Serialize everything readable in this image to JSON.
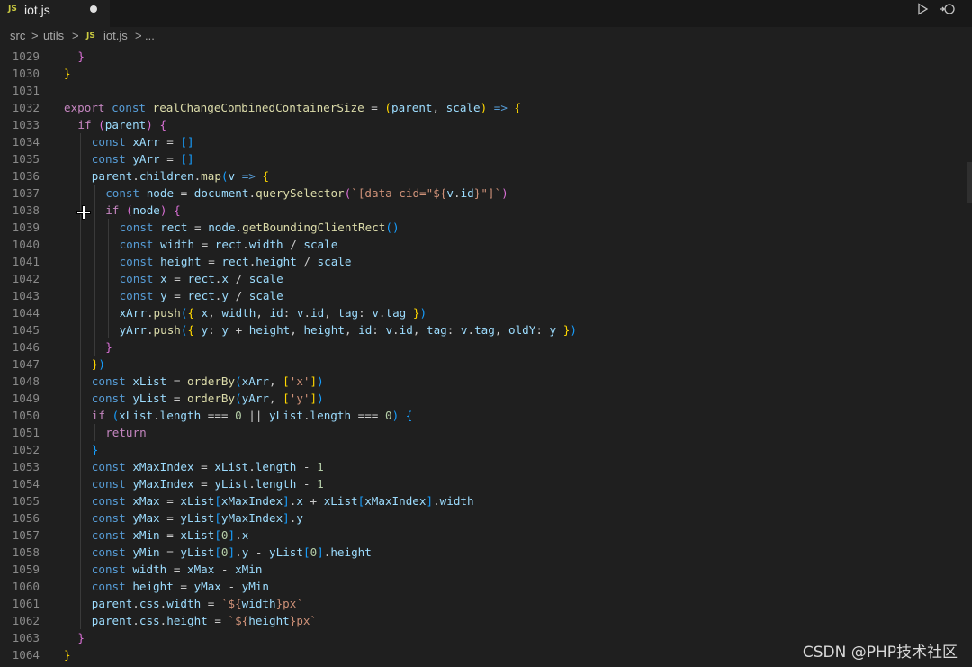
{
  "tab": {
    "badge": "JS",
    "title": "iot.js"
  },
  "toolbar": {
    "run_icon": "play-icon",
    "split_icon": "split-editor-icon"
  },
  "breadcrumb": {
    "src": "src",
    "sep1": ">",
    "utils": "utils",
    "sep2": ">",
    "badge": "JS",
    "file": "iot.js",
    "sep3": ">",
    "more": "..."
  },
  "watermark": "CSDN @PHP技术社区",
  "lines": [
    {
      "n": "1029",
      "ind": 1,
      "t": [
        [
          "}",
          "b2"
        ]
      ]
    },
    {
      "n": "1030",
      "ind": 0,
      "t": [
        [
          "}",
          "b1"
        ]
      ]
    },
    {
      "n": "1031",
      "ind": 0,
      "t": []
    },
    {
      "n": "1032",
      "ind": 0,
      "t": [
        [
          "export",
          "kwc"
        ],
        [
          " "
        ],
        [
          "const",
          "kw"
        ],
        [
          " "
        ],
        [
          "realChangeCombinedContainerSize",
          "fn"
        ],
        [
          " = "
        ],
        [
          "(",
          "b1"
        ],
        [
          "parent",
          "vr"
        ],
        [
          ", "
        ],
        [
          "scale",
          "vr"
        ],
        [
          ")",
          "b1"
        ],
        [
          " "
        ],
        [
          "=>",
          "kw"
        ],
        [
          " "
        ],
        [
          "{",
          "b1"
        ]
      ]
    },
    {
      "n": "1033",
      "ind": 1,
      "t": [
        [
          "if",
          "kwc"
        ],
        [
          " "
        ],
        [
          "(",
          "b2"
        ],
        [
          "parent",
          "vr"
        ],
        [
          ")",
          "b2"
        ],
        [
          " "
        ],
        [
          "{",
          "b2"
        ]
      ]
    },
    {
      "n": "1034",
      "ind": 2,
      "t": [
        [
          "const",
          "kw"
        ],
        [
          " "
        ],
        [
          "xArr",
          "vr"
        ],
        [
          " = "
        ],
        [
          "[]",
          "b3"
        ]
      ]
    },
    {
      "n": "1035",
      "ind": 2,
      "t": [
        [
          "const",
          "kw"
        ],
        [
          " "
        ],
        [
          "yArr",
          "vr"
        ],
        [
          " = "
        ],
        [
          "[]",
          "b3"
        ]
      ]
    },
    {
      "n": "1036",
      "ind": 2,
      "t": [
        [
          "parent",
          "vr"
        ],
        [
          "."
        ],
        [
          "children",
          "vr"
        ],
        [
          "."
        ],
        [
          "map",
          "fn"
        ],
        [
          "(",
          "b3"
        ],
        [
          "v",
          "vr"
        ],
        [
          " "
        ],
        [
          "=>",
          "kw"
        ],
        [
          " "
        ],
        [
          "{",
          "b1"
        ]
      ]
    },
    {
      "n": "1037",
      "ind": 3,
      "t": [
        [
          "const",
          "kw"
        ],
        [
          " "
        ],
        [
          "node",
          "vr"
        ],
        [
          " = "
        ],
        [
          "document",
          "vr"
        ],
        [
          "."
        ],
        [
          "querySelector",
          "fn"
        ],
        [
          "(",
          "b2"
        ],
        [
          "`[data-cid=\"${",
          "st"
        ],
        [
          "v",
          "vr"
        ],
        [
          "."
        ],
        [
          "id",
          "vr"
        ],
        [
          "}\"]`",
          "st"
        ],
        [
          ")",
          "b2"
        ]
      ]
    },
    {
      "n": "1038",
      "ind": 3,
      "t": [
        [
          "if",
          "kwc"
        ],
        [
          " "
        ],
        [
          "(",
          "b2"
        ],
        [
          "node",
          "vr"
        ],
        [
          ")",
          "b2"
        ],
        [
          " "
        ],
        [
          "{",
          "b2"
        ]
      ]
    },
    {
      "n": "1039",
      "ind": 4,
      "t": [
        [
          "const",
          "kw"
        ],
        [
          " "
        ],
        [
          "rect",
          "vr"
        ],
        [
          " = "
        ],
        [
          "node",
          "vr"
        ],
        [
          "."
        ],
        [
          "getBoundingClientRect",
          "fn"
        ],
        [
          "()",
          "b3"
        ]
      ]
    },
    {
      "n": "1040",
      "ind": 4,
      "t": [
        [
          "const",
          "kw"
        ],
        [
          " "
        ],
        [
          "width",
          "vr"
        ],
        [
          " = "
        ],
        [
          "rect",
          "vr"
        ],
        [
          "."
        ],
        [
          "width",
          "vr"
        ],
        [
          " / "
        ],
        [
          "scale",
          "vr"
        ]
      ]
    },
    {
      "n": "1041",
      "ind": 4,
      "t": [
        [
          "const",
          "kw"
        ],
        [
          " "
        ],
        [
          "height",
          "vr"
        ],
        [
          " = "
        ],
        [
          "rect",
          "vr"
        ],
        [
          "."
        ],
        [
          "height",
          "vr"
        ],
        [
          " / "
        ],
        [
          "scale",
          "vr"
        ]
      ]
    },
    {
      "n": "1042",
      "ind": 4,
      "t": [
        [
          "const",
          "kw"
        ],
        [
          " "
        ],
        [
          "x",
          "vr"
        ],
        [
          " = "
        ],
        [
          "rect",
          "vr"
        ],
        [
          "."
        ],
        [
          "x",
          "vr"
        ],
        [
          " / "
        ],
        [
          "scale",
          "vr"
        ]
      ]
    },
    {
      "n": "1043",
      "ind": 4,
      "t": [
        [
          "const",
          "kw"
        ],
        [
          " "
        ],
        [
          "y",
          "vr"
        ],
        [
          " = "
        ],
        [
          "rect",
          "vr"
        ],
        [
          "."
        ],
        [
          "y",
          "vr"
        ],
        [
          " / "
        ],
        [
          "scale",
          "vr"
        ]
      ]
    },
    {
      "n": "1044",
      "ind": 4,
      "t": [
        [
          "xArr",
          "vr"
        ],
        [
          "."
        ],
        [
          "push",
          "fn"
        ],
        [
          "(",
          "b3"
        ],
        [
          "{",
          "b1"
        ],
        [
          " "
        ],
        [
          "x",
          "vr"
        ],
        [
          ", "
        ],
        [
          "width",
          "vr"
        ],
        [
          ", "
        ],
        [
          "id",
          "vr"
        ],
        [
          ": "
        ],
        [
          "v",
          "vr"
        ],
        [
          "."
        ],
        [
          "id",
          "vr"
        ],
        [
          ", "
        ],
        [
          "tag",
          "vr"
        ],
        [
          ": "
        ],
        [
          "v",
          "vr"
        ],
        [
          "."
        ],
        [
          "tag",
          "vr"
        ],
        [
          " "
        ],
        [
          "}",
          "b1"
        ],
        [
          ")",
          "b3"
        ]
      ]
    },
    {
      "n": "1045",
      "ind": 4,
      "t": [
        [
          "yArr",
          "vr"
        ],
        [
          "."
        ],
        [
          "push",
          "fn"
        ],
        [
          "(",
          "b3"
        ],
        [
          "{",
          "b1"
        ],
        [
          " "
        ],
        [
          "y",
          "vr"
        ],
        [
          ": "
        ],
        [
          "y",
          "vr"
        ],
        [
          " + "
        ],
        [
          "height",
          "vr"
        ],
        [
          ", "
        ],
        [
          "height",
          "vr"
        ],
        [
          ", "
        ],
        [
          "id",
          "vr"
        ],
        [
          ": "
        ],
        [
          "v",
          "vr"
        ],
        [
          "."
        ],
        [
          "id",
          "vr"
        ],
        [
          ", "
        ],
        [
          "tag",
          "vr"
        ],
        [
          ": "
        ],
        [
          "v",
          "vr"
        ],
        [
          "."
        ],
        [
          "tag",
          "vr"
        ],
        [
          ", "
        ],
        [
          "oldY",
          "vr"
        ],
        [
          ": "
        ],
        [
          "y",
          "vr"
        ],
        [
          " "
        ],
        [
          "}",
          "b1"
        ],
        [
          ")",
          "b3"
        ]
      ]
    },
    {
      "n": "1046",
      "ind": 3,
      "t": [
        [
          "}",
          "b2"
        ]
      ]
    },
    {
      "n": "1047",
      "ind": 2,
      "t": [
        [
          "}",
          "b1"
        ],
        [
          ")",
          "b3"
        ]
      ]
    },
    {
      "n": "1048",
      "ind": 2,
      "t": [
        [
          "const",
          "kw"
        ],
        [
          " "
        ],
        [
          "xList",
          "vr"
        ],
        [
          " = "
        ],
        [
          "orderBy",
          "fn"
        ],
        [
          "(",
          "b3"
        ],
        [
          "xArr",
          "vr"
        ],
        [
          ", "
        ],
        [
          "[",
          "b1"
        ],
        [
          "'x'",
          "st"
        ],
        [
          "]",
          "b1"
        ],
        [
          ")",
          "b3"
        ]
      ]
    },
    {
      "n": "1049",
      "ind": 2,
      "t": [
        [
          "const",
          "kw"
        ],
        [
          " "
        ],
        [
          "yList",
          "vr"
        ],
        [
          " = "
        ],
        [
          "orderBy",
          "fn"
        ],
        [
          "(",
          "b3"
        ],
        [
          "yArr",
          "vr"
        ],
        [
          ", "
        ],
        [
          "[",
          "b1"
        ],
        [
          "'y'",
          "st"
        ],
        [
          "]",
          "b1"
        ],
        [
          ")",
          "b3"
        ]
      ]
    },
    {
      "n": "1050",
      "ind": 2,
      "t": [
        [
          "if",
          "kwc"
        ],
        [
          " "
        ],
        [
          "(",
          "b3"
        ],
        [
          "xList",
          "vr"
        ],
        [
          "."
        ],
        [
          "length",
          "vr"
        ],
        [
          " === "
        ],
        [
          "0",
          "nm"
        ],
        [
          " || "
        ],
        [
          "yList",
          "vr"
        ],
        [
          "."
        ],
        [
          "length",
          "vr"
        ],
        [
          " === "
        ],
        [
          "0",
          "nm"
        ],
        [
          ")",
          "b3"
        ],
        [
          " "
        ],
        [
          "{",
          "b3"
        ]
      ]
    },
    {
      "n": "1051",
      "ind": 3,
      "t": [
        [
          "return",
          "kwc"
        ]
      ]
    },
    {
      "n": "1052",
      "ind": 2,
      "t": [
        [
          "}",
          "b3"
        ]
      ]
    },
    {
      "n": "1053",
      "ind": 2,
      "t": [
        [
          "const",
          "kw"
        ],
        [
          " "
        ],
        [
          "xMaxIndex",
          "vr"
        ],
        [
          " = "
        ],
        [
          "xList",
          "vr"
        ],
        [
          "."
        ],
        [
          "length",
          "vr"
        ],
        [
          " - "
        ],
        [
          "1",
          "nm"
        ]
      ]
    },
    {
      "n": "1054",
      "ind": 2,
      "t": [
        [
          "const",
          "kw"
        ],
        [
          " "
        ],
        [
          "yMaxIndex",
          "vr"
        ],
        [
          " = "
        ],
        [
          "yList",
          "vr"
        ],
        [
          "."
        ],
        [
          "length",
          "vr"
        ],
        [
          " - "
        ],
        [
          "1",
          "nm"
        ]
      ]
    },
    {
      "n": "1055",
      "ind": 2,
      "t": [
        [
          "const",
          "kw"
        ],
        [
          " "
        ],
        [
          "xMax",
          "vr"
        ],
        [
          " = "
        ],
        [
          "xList",
          "vr"
        ],
        [
          "[",
          "b3"
        ],
        [
          "xMaxIndex",
          "vr"
        ],
        [
          "]",
          "b3"
        ],
        [
          "."
        ],
        [
          "x",
          "vr"
        ],
        [
          " + "
        ],
        [
          "xList",
          "vr"
        ],
        [
          "[",
          "b3"
        ],
        [
          "xMaxIndex",
          "vr"
        ],
        [
          "]",
          "b3"
        ],
        [
          "."
        ],
        [
          "width",
          "vr"
        ]
      ]
    },
    {
      "n": "1056",
      "ind": 2,
      "t": [
        [
          "const",
          "kw"
        ],
        [
          " "
        ],
        [
          "yMax",
          "vr"
        ],
        [
          " = "
        ],
        [
          "yList",
          "vr"
        ],
        [
          "[",
          "b3"
        ],
        [
          "yMaxIndex",
          "vr"
        ],
        [
          "]",
          "b3"
        ],
        [
          "."
        ],
        [
          "y",
          "vr"
        ]
      ]
    },
    {
      "n": "1057",
      "ind": 2,
      "t": [
        [
          "const",
          "kw"
        ],
        [
          " "
        ],
        [
          "xMin",
          "vr"
        ],
        [
          " = "
        ],
        [
          "xList",
          "vr"
        ],
        [
          "[",
          "b3"
        ],
        [
          "0",
          "nm"
        ],
        [
          "]",
          "b3"
        ],
        [
          "."
        ],
        [
          "x",
          "vr"
        ]
      ]
    },
    {
      "n": "1058",
      "ind": 2,
      "t": [
        [
          "const",
          "kw"
        ],
        [
          " "
        ],
        [
          "yMin",
          "vr"
        ],
        [
          " = "
        ],
        [
          "yList",
          "vr"
        ],
        [
          "[",
          "b3"
        ],
        [
          "0",
          "nm"
        ],
        [
          "]",
          "b3"
        ],
        [
          "."
        ],
        [
          "y",
          "vr"
        ],
        [
          " - "
        ],
        [
          "yList",
          "vr"
        ],
        [
          "[",
          "b3"
        ],
        [
          "0",
          "nm"
        ],
        [
          "]",
          "b3"
        ],
        [
          "."
        ],
        [
          "height",
          "vr"
        ]
      ]
    },
    {
      "n": "1059",
      "ind": 2,
      "t": [
        [
          "const",
          "kw"
        ],
        [
          " "
        ],
        [
          "width",
          "vr"
        ],
        [
          " = "
        ],
        [
          "xMax",
          "vr"
        ],
        [
          " - "
        ],
        [
          "xMin",
          "vr"
        ]
      ]
    },
    {
      "n": "1060",
      "ind": 2,
      "t": [
        [
          "const",
          "kw"
        ],
        [
          " "
        ],
        [
          "height",
          "vr"
        ],
        [
          " = "
        ],
        [
          "yMax",
          "vr"
        ],
        [
          " - "
        ],
        [
          "yMin",
          "vr"
        ]
      ]
    },
    {
      "n": "1061",
      "ind": 2,
      "t": [
        [
          "parent",
          "vr"
        ],
        [
          "."
        ],
        [
          "css",
          "vr"
        ],
        [
          "."
        ],
        [
          "width",
          "vr"
        ],
        [
          " = "
        ],
        [
          "`${",
          "st"
        ],
        [
          "width",
          "vr"
        ],
        [
          "}px`",
          "st"
        ]
      ]
    },
    {
      "n": "1062",
      "ind": 2,
      "t": [
        [
          "parent",
          "vr"
        ],
        [
          "."
        ],
        [
          "css",
          "vr"
        ],
        [
          "."
        ],
        [
          "height",
          "vr"
        ],
        [
          " = "
        ],
        [
          "`${",
          "st"
        ],
        [
          "height",
          "vr"
        ],
        [
          "}px`",
          "st"
        ]
      ]
    },
    {
      "n": "1063",
      "ind": 1,
      "t": [
        [
          "}",
          "b2"
        ]
      ]
    },
    {
      "n": "1064",
      "ind": 0,
      "t": [
        [
          "}",
          "b1"
        ]
      ]
    }
  ]
}
